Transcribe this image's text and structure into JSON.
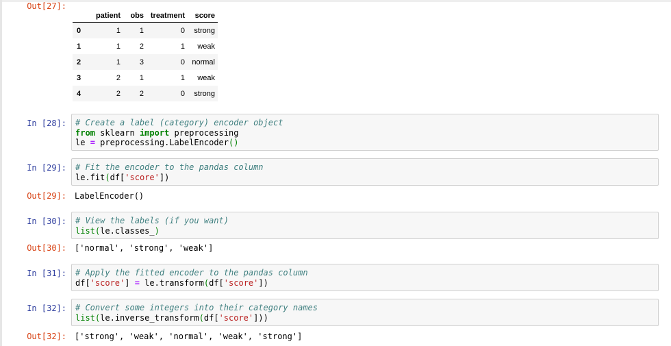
{
  "cells": {
    "out27": {
      "prompt": "Out[27]:"
    },
    "in28": {
      "prompt": "In [28]:",
      "comment": "# Create a label (category) encoder object",
      "kw_from": "from",
      "module": " sklearn ",
      "kw_import": "import",
      "name": " preprocessing",
      "line3_a": "le ",
      "op_eq": "=",
      "line3_b": " preprocessing.LabelEncoder",
      "parens": "()"
    },
    "in29": {
      "prompt": "In [29]:",
      "comment": "# Fit the encoder to the pandas column",
      "l2_a": "le.fit",
      "l2_p1": "(",
      "l2_b": "df[",
      "l2_s": "'score'",
      "l2_c": "])"
    },
    "out29": {
      "prompt": "Out[29]:",
      "text": "LabelEncoder()"
    },
    "in30": {
      "prompt": "In [30]:",
      "comment": "# View the labels (if you want)",
      "l2_a": "list",
      "l2_p1": "(",
      "l2_b": "le.classes_",
      "l2_p2": ")"
    },
    "out30": {
      "prompt": "Out[30]:",
      "text": "['normal', 'strong', 'weak']"
    },
    "in31": {
      "prompt": "In [31]:",
      "comment": "# Apply the fitted encoder to the pandas column",
      "l2_a": "df[",
      "l2_s1": "'score'",
      "l2_b": "] ",
      "op_eq": "=",
      "l2_c": " le.transform",
      "l2_p1": "(",
      "l2_d": "df[",
      "l2_s2": "'score'",
      "l2_e": "])"
    },
    "in32": {
      "prompt": "In [32]:",
      "comment": "# Convert some integers into their category names",
      "l2_a": "list",
      "l2_p1": "(",
      "l2_b": "le.inverse_transform",
      "l2_p2": "(",
      "l2_c": "df[",
      "l2_s": "'score'",
      "l2_d": "]))"
    },
    "out32": {
      "prompt": "Out[32]:",
      "text": "['strong', 'weak', 'normal', 'weak', 'strong']"
    }
  },
  "dataframe": {
    "columns": [
      "",
      "patient",
      "obs",
      "treatment",
      "score"
    ],
    "rows": [
      {
        "index": "0",
        "patient": "1",
        "obs": "1",
        "treatment": "0",
        "score": "strong"
      },
      {
        "index": "1",
        "patient": "1",
        "obs": "2",
        "treatment": "1",
        "score": "weak"
      },
      {
        "index": "2",
        "patient": "1",
        "obs": "3",
        "treatment": "0",
        "score": "normal"
      },
      {
        "index": "3",
        "patient": "2",
        "obs": "1",
        "treatment": "1",
        "score": "weak"
      },
      {
        "index": "4",
        "patient": "2",
        "obs": "2",
        "treatment": "0",
        "score": "strong"
      }
    ]
  }
}
